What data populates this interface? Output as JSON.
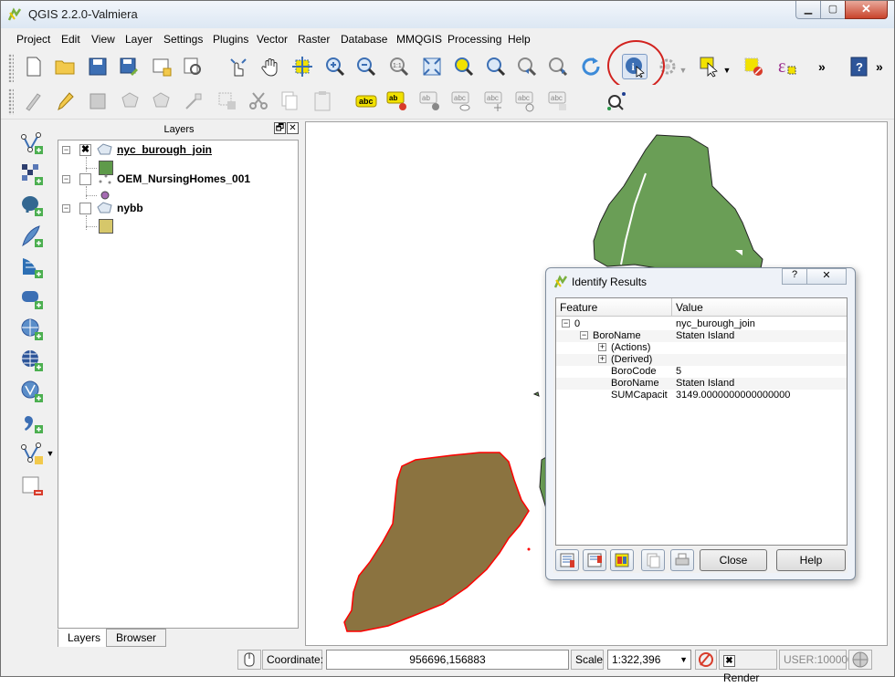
{
  "window": {
    "title": "QGIS 2.2.0-Valmiera"
  },
  "menu": [
    "Project",
    "Edit",
    "View",
    "Layer",
    "Settings",
    "Plugins",
    "Vector",
    "Raster",
    "Database",
    "MMQGIS",
    "Processing",
    "Help"
  ],
  "toolbar_more": "»",
  "layers_panel": {
    "title": "Layers",
    "float_btn": "🗗",
    "close_btn": "✕",
    "layers": [
      {
        "name": "nyc_burough_join",
        "checked": "✖",
        "color": "#5e9a4a"
      },
      {
        "name": "OEM_NursingHomes_001",
        "checked": "",
        "color": "#a56bb2"
      },
      {
        "name": "nybb",
        "checked": "",
        "color": "#d6c76a"
      }
    ],
    "tabs": [
      "Layers",
      "Browser"
    ]
  },
  "map": {
    "fill_green": "#6a9e56",
    "fill_brown": "#8b7340",
    "selection": "#ff0000"
  },
  "identify": {
    "title": "Identify Results",
    "help_btn": "?",
    "close_x": "✕",
    "headers": {
      "feature": "Feature",
      "value": "Value"
    },
    "rows": [
      {
        "feature": "0",
        "value": "nyc_burough_join"
      },
      {
        "feature": "BoroName",
        "value": "Staten Island"
      },
      {
        "feature": "(Actions)",
        "value": ""
      },
      {
        "feature": "(Derived)",
        "value": ""
      },
      {
        "feature": "BoroCode",
        "value": "5"
      },
      {
        "feature": "BoroName",
        "value": "Staten Island"
      },
      {
        "feature": "SUMCapacit",
        "value": "3149.0000000000000000"
      }
    ],
    "close_label": "Close",
    "help_label": "Help"
  },
  "status": {
    "coordinate_label": "Coordinate:",
    "coordinate_value": "956696,156883",
    "scale_label": "Scale",
    "scale_value": "1:322,396",
    "render_label": "Render",
    "crs_label": "USER:100000"
  }
}
